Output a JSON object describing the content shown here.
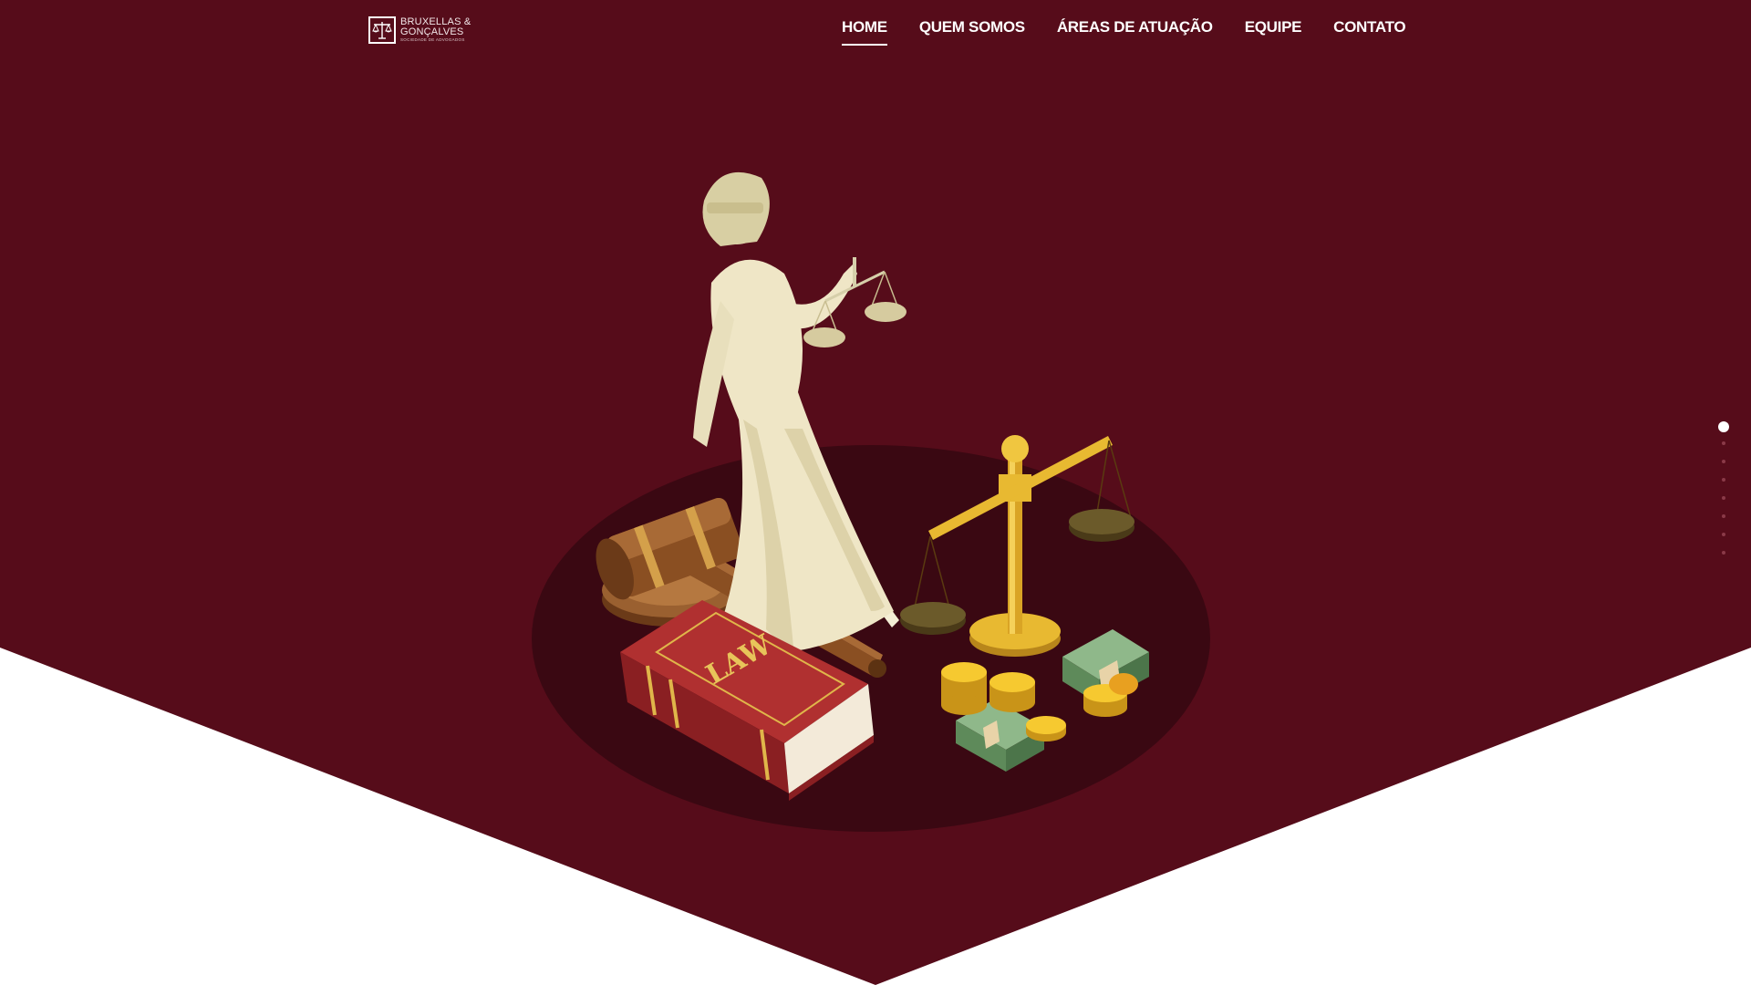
{
  "brand": {
    "line1": "BRUXELLAS &",
    "line2": "GONÇALVES",
    "tagline": "SOCIEDADE DE ADVOGADOS",
    "icon": "scales-logo-icon"
  },
  "nav": {
    "items": [
      {
        "label": "HOME",
        "active": true
      },
      {
        "label": "QUEM SOMOS",
        "active": false
      },
      {
        "label": "ÁREAS DE ATUAÇÃO",
        "active": false
      },
      {
        "label": "EQUIPE",
        "active": false
      },
      {
        "label": "CONTATO",
        "active": false
      }
    ]
  },
  "hero": {
    "book_label": "LAW",
    "illustration": "lady-justice-illustration"
  },
  "pagination": {
    "count": 8,
    "active_index": 0
  },
  "colors": {
    "primary": "#560c1a",
    "shadow": "#3a0812",
    "background": "#ffffff",
    "nav_text": "#ffffff",
    "gold": "#e8b931",
    "statue": "#efe6c6",
    "book": "#a5282a",
    "gavel": "#8a5428"
  }
}
